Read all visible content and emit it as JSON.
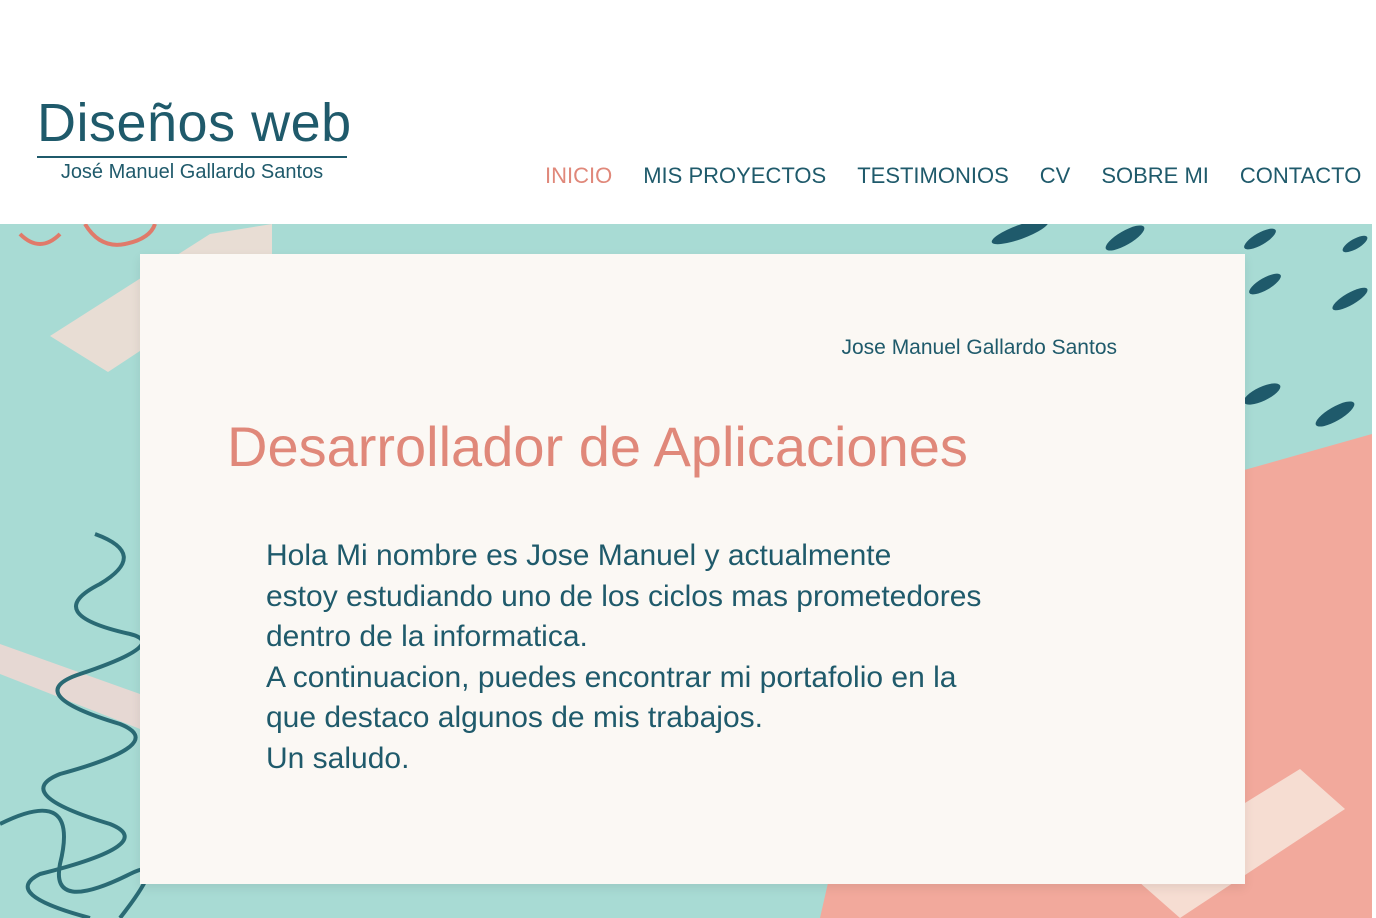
{
  "header": {
    "logo_title": "Diseños web",
    "logo_subtitle": "José Manuel Gallardo Santos"
  },
  "nav": {
    "items": [
      {
        "label": "INICIO",
        "active": true
      },
      {
        "label": "MIS PROYECTOS",
        "active": false
      },
      {
        "label": "TESTIMONIOS",
        "active": false
      },
      {
        "label": "CV",
        "active": false
      },
      {
        "label": "SOBRE MI",
        "active": false
      },
      {
        "label": "CONTACTO",
        "active": false
      }
    ]
  },
  "hero": {
    "author": "Jose Manuel Gallardo Santos",
    "heading": "Desarrollador de Aplicaciones",
    "body_lines": [
      "Hola Mi nombre es Jose Manuel y actualmente",
      "estoy estudiando uno de los ciclos mas prometedores",
      "dentro de la informatica.",
      "A continuacion, puedes encontrar mi portafolio en la",
      "que destaco algunos de mis trabajos.",
      "Un saludo."
    ]
  },
  "colors": {
    "primary": "#1f5a6b",
    "accent": "#e0887a",
    "mint": "#a8dbd4",
    "coral": "#f2a99c",
    "paper": "#fbf8f4"
  }
}
